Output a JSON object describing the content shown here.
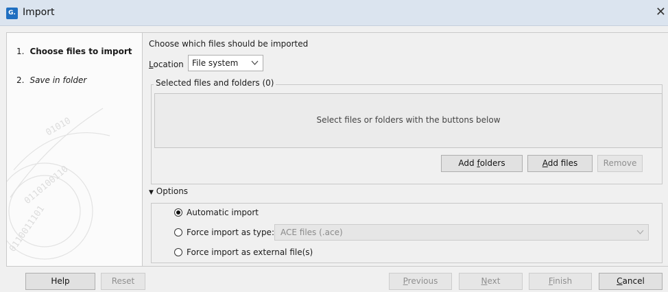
{
  "window": {
    "title": "Import",
    "icon_text": "G.",
    "close_glyph": "✕"
  },
  "steps": [
    {
      "number": "1.",
      "label": "Choose files to import"
    },
    {
      "number": "2.",
      "label": "Save in folder"
    }
  ],
  "main": {
    "heading": "Choose which files should be imported",
    "location": {
      "label_first": "L",
      "label_rest": "ocation",
      "value": "File system"
    },
    "selected_group": {
      "legend": "Selected files and folders (0)",
      "placeholder": "Select files or folders with the buttons below"
    },
    "buttons": {
      "add_folders": {
        "pre": "Add ",
        "u": "f",
        "post": "olders"
      },
      "add_files": {
        "pre": "",
        "u": "A",
        "post": "dd files"
      },
      "remove": "Remove"
    },
    "options": {
      "toggle_arrow": "▼",
      "label": "Options",
      "automatic": "Automatic import",
      "force_type": "Force import as type:",
      "force_type_value": "ACE files (.ace)",
      "force_external": "Force import as external file(s)",
      "selected": "automatic"
    }
  },
  "footer": {
    "help": "Help",
    "reset": "Reset",
    "previous": {
      "u": "P",
      "rest": "revious"
    },
    "next": {
      "u": "N",
      "rest": "ext"
    },
    "finish": {
      "u": "F",
      "rest": "inish"
    },
    "cancel": {
      "u": "C",
      "rest": "ancel"
    }
  }
}
